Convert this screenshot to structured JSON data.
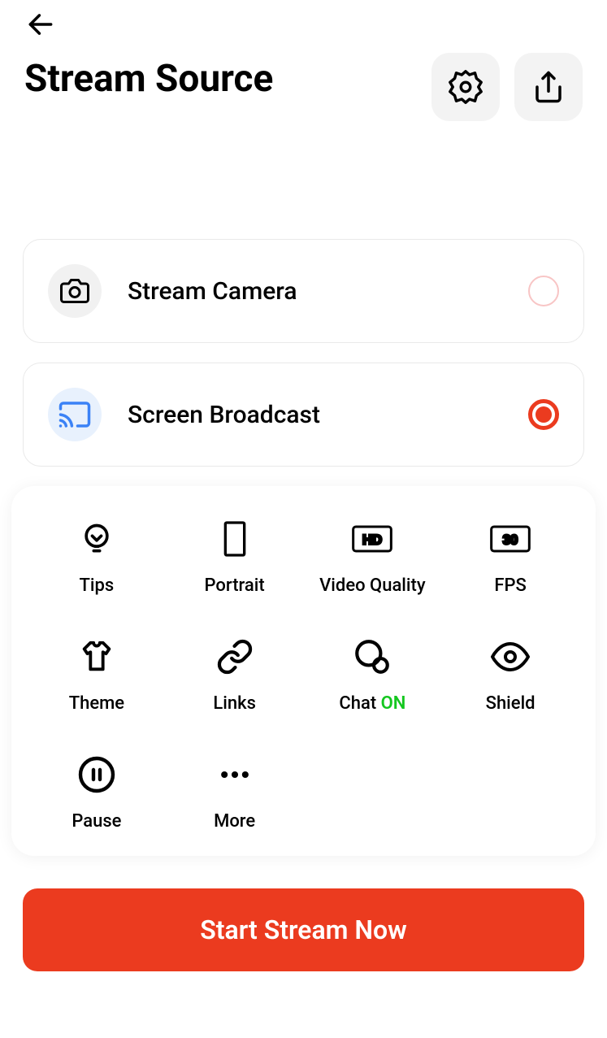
{
  "header": {
    "title": "Stream Source"
  },
  "sources": [
    {
      "label": "Stream Camera",
      "selected": false
    },
    {
      "label": "Screen Broadcast",
      "selected": true
    }
  ],
  "options": {
    "tips": "Tips",
    "portrait": "Portrait",
    "videoQuality": "Video Quality",
    "videoQualityBadge": "HD",
    "fps": "FPS",
    "fpsBadge": "30",
    "theme": "Theme",
    "links": "Links",
    "chat": "Chat",
    "chatStatus": "ON",
    "shield": "Shield",
    "pause": "Pause",
    "more": "More"
  },
  "cta": "Start Stream Now"
}
